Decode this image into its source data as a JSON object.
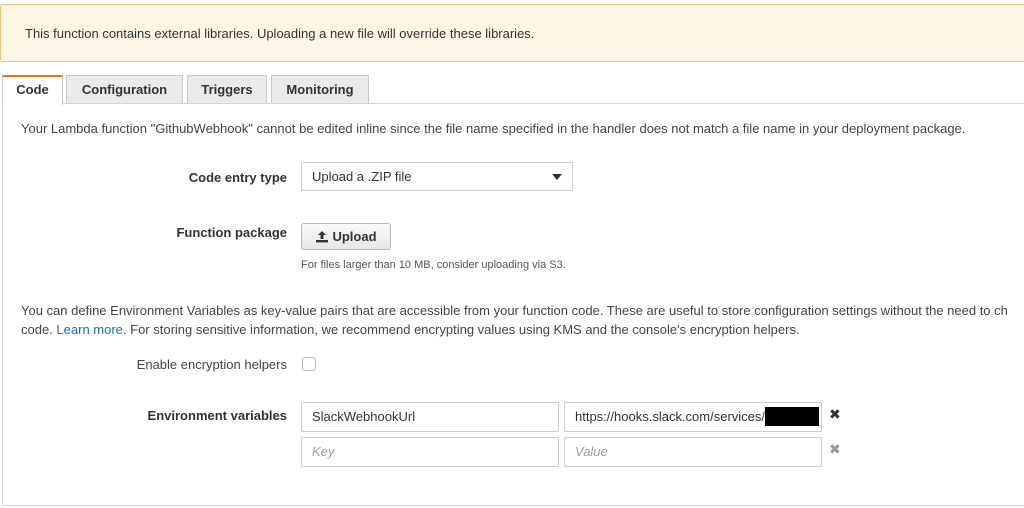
{
  "banner": {
    "text": "This function contains external libraries. Uploading a new file will override these libraries."
  },
  "tabs": [
    {
      "label": "Code"
    },
    {
      "label": "Configuration"
    },
    {
      "label": "Triggers"
    },
    {
      "label": "Monitoring"
    }
  ],
  "code": {
    "inline_notice": "Your Lambda function \"GithubWebhook\" cannot be edited inline since the file name specified in the handler does not match a file name in your deployment package.",
    "entry_type_label": "Code entry type",
    "entry_type_value": "Upload a .ZIP file",
    "package_label": "Function package",
    "upload_label": "Upload",
    "upload_hint": "For files larger than 10 MB, consider uploading via S3.",
    "env_info_1": "You can define Environment Variables as key-value pairs that are accessible from your function code. These are useful to store configuration settings without the need to ch",
    "env_info_2_pre": "code. ",
    "learn_more": "Learn more.",
    "env_info_2_post": " For storing sensitive information, we recommend encrypting values using KMS and the console's encryption helpers.",
    "encryption_label": "Enable encryption helpers",
    "encryption_checked": false,
    "env_label": "Environment variables",
    "env_vars": [
      {
        "key": "SlackWebhookUrl",
        "value": "https://hooks.slack.com/services/"
      }
    ],
    "new_var": {
      "key_placeholder": "Key",
      "value_placeholder": "Value"
    }
  },
  "icons": {
    "remove": "close-icon",
    "upload": "upload-icon"
  },
  "colors": {
    "active_tab_accent": "#e7761b",
    "link": "#1a6fb8",
    "banner_bg": "#fef6e5",
    "banner_border": "#f1c27d"
  }
}
